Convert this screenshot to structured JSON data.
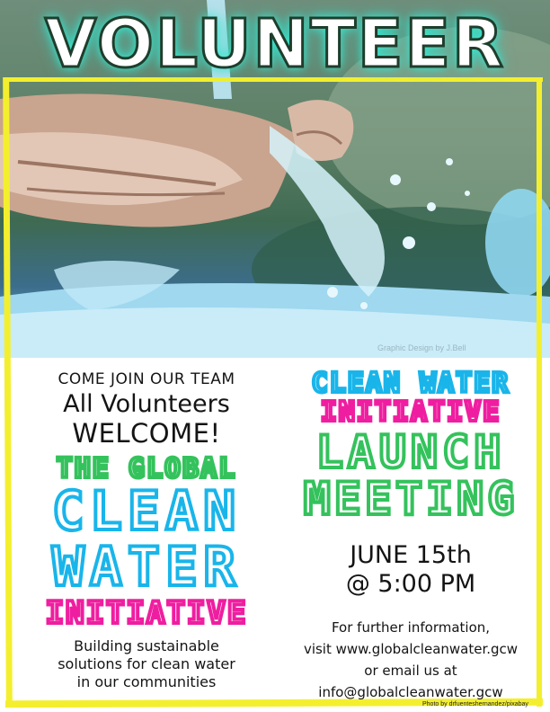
{
  "title": "VOLUNTEER",
  "photo_credit_graphic": "Graphic Design by J.Bell",
  "left": {
    "line1": "COME JOIN OUR TEAM",
    "line2": "All Volunteers",
    "line3": "WELCOME!",
    "org_line1": "THE GLOBAL",
    "org_line2": "CLEAN",
    "org_line3": "WATER",
    "org_line4": "INITIATIVE",
    "tagline": [
      "Building sustainable",
      "solutions for clean water",
      "in our communities"
    ]
  },
  "right": {
    "event_line1": "CLEAN WATER",
    "event_line2": "INITIATIVE",
    "event_line3": "LAUNCH",
    "event_line4": "MEETING",
    "date": "JUNE 15th",
    "time": "@ 5:00 PM",
    "info": [
      "For further information,",
      "visit www.globalcleanwater.gcw",
      "or email us at",
      "info@globalcleanwater.gcw"
    ]
  },
  "photo_credit": "Photo by drfuenteshernandez/pixabay",
  "colors": {
    "green": "#34c25c",
    "blue": "#19b5ea",
    "pink": "#ef1ea0",
    "frame_yellow": "#f4ef2e",
    "title_glow": "#3bf0d6"
  }
}
